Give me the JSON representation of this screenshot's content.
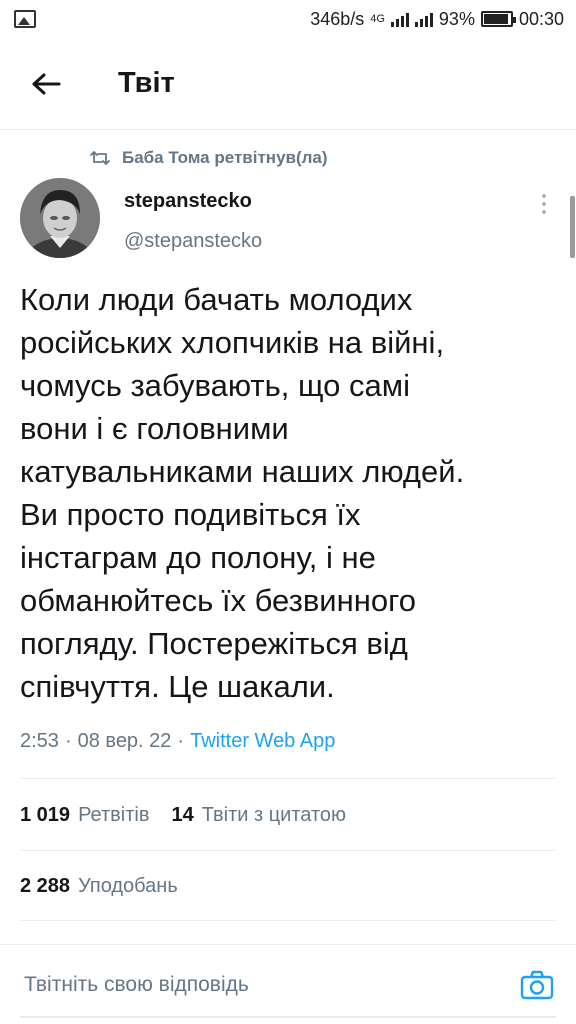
{
  "status_bar": {
    "net_speed": "346b/s",
    "network_label": "4G",
    "battery": "93%",
    "time": "00:30"
  },
  "header": {
    "title": "Твіт"
  },
  "tweet": {
    "retweeted_by": "Баба Тома ретвітнув(ла)",
    "author_name": "stepanstecko",
    "author_handle": "@stepanstecko",
    "text": "Коли люди бачать молодих\nросійських хлопчиків на війні,\nчомусь забувають, що самі\nвони і є головними\nкатувальниками наших людей.\nВи просто подивіться їх\nінстаграм до полону, і не\nобманюйтесь їх безвинного\nпогляду. Постережіться від\nспівчуття. Це шакали.",
    "time": "2:53",
    "date": "08 вер. 22",
    "source": "Twitter Web App",
    "sep": "·"
  },
  "stats": {
    "retweets_count": "1 019",
    "retweets_label": "Ретвітів",
    "quotes_count": "14",
    "quotes_label": "Твіти з цитатою",
    "likes_count": "2 288",
    "likes_label": "Уподобань"
  },
  "reply": {
    "placeholder": "Твітніть свою відповідь"
  },
  "colors": {
    "accent": "#1da1f2",
    "text_primary": "#14171a",
    "text_secondary": "#657786",
    "divider": "#e6ecf0"
  }
}
